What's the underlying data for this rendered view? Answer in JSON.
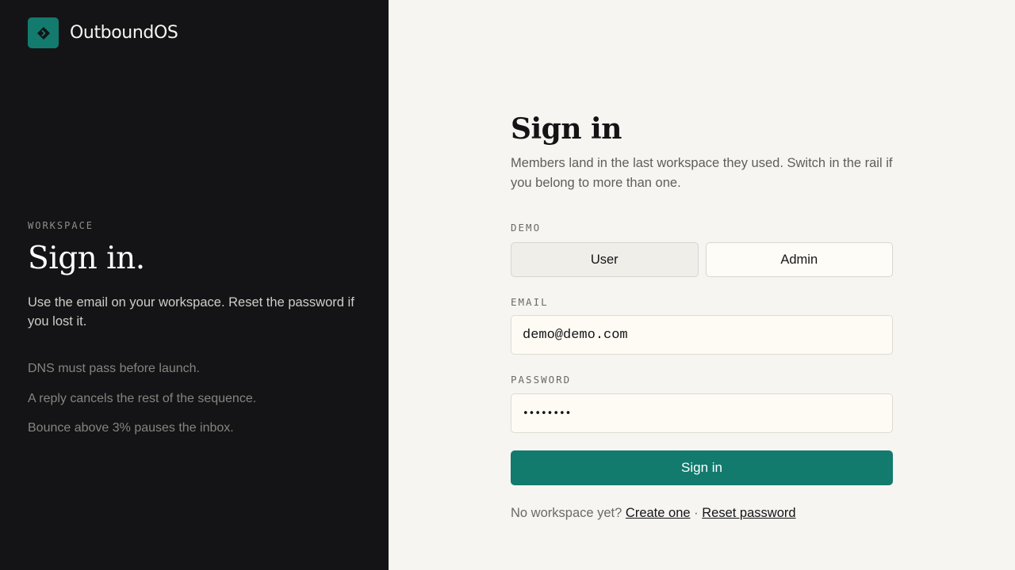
{
  "brand": {
    "name": "OutboundOS",
    "logo_icon": "chevron-diamond-icon",
    "accent": "#137a6e"
  },
  "left_panel": {
    "eyebrow": "WORKSPACE",
    "title": "Sign in.",
    "description": "Use the email on your workspace. Reset the password if you lost it.",
    "tips": [
      "DNS must pass before launch.",
      "A reply cancels the rest of the sequence.",
      "Bounce above 3% pauses the inbox."
    ]
  },
  "form": {
    "title": "Sign in",
    "subtitle": "Members land in the last workspace they used. Switch in the rail if you belong to more than one.",
    "demo_label": "DEMO",
    "demo_options": [
      "User",
      "Admin"
    ],
    "demo_selected": "User",
    "email_label": "EMAIL",
    "email_value": "demo@demo.com",
    "password_label": "PASSWORD",
    "password_value": "••••••••",
    "submit_label": "Sign in",
    "footer_prefix": "No workspace yet?",
    "create_link": "Create one",
    "separator": "·",
    "reset_link": "Reset password"
  }
}
